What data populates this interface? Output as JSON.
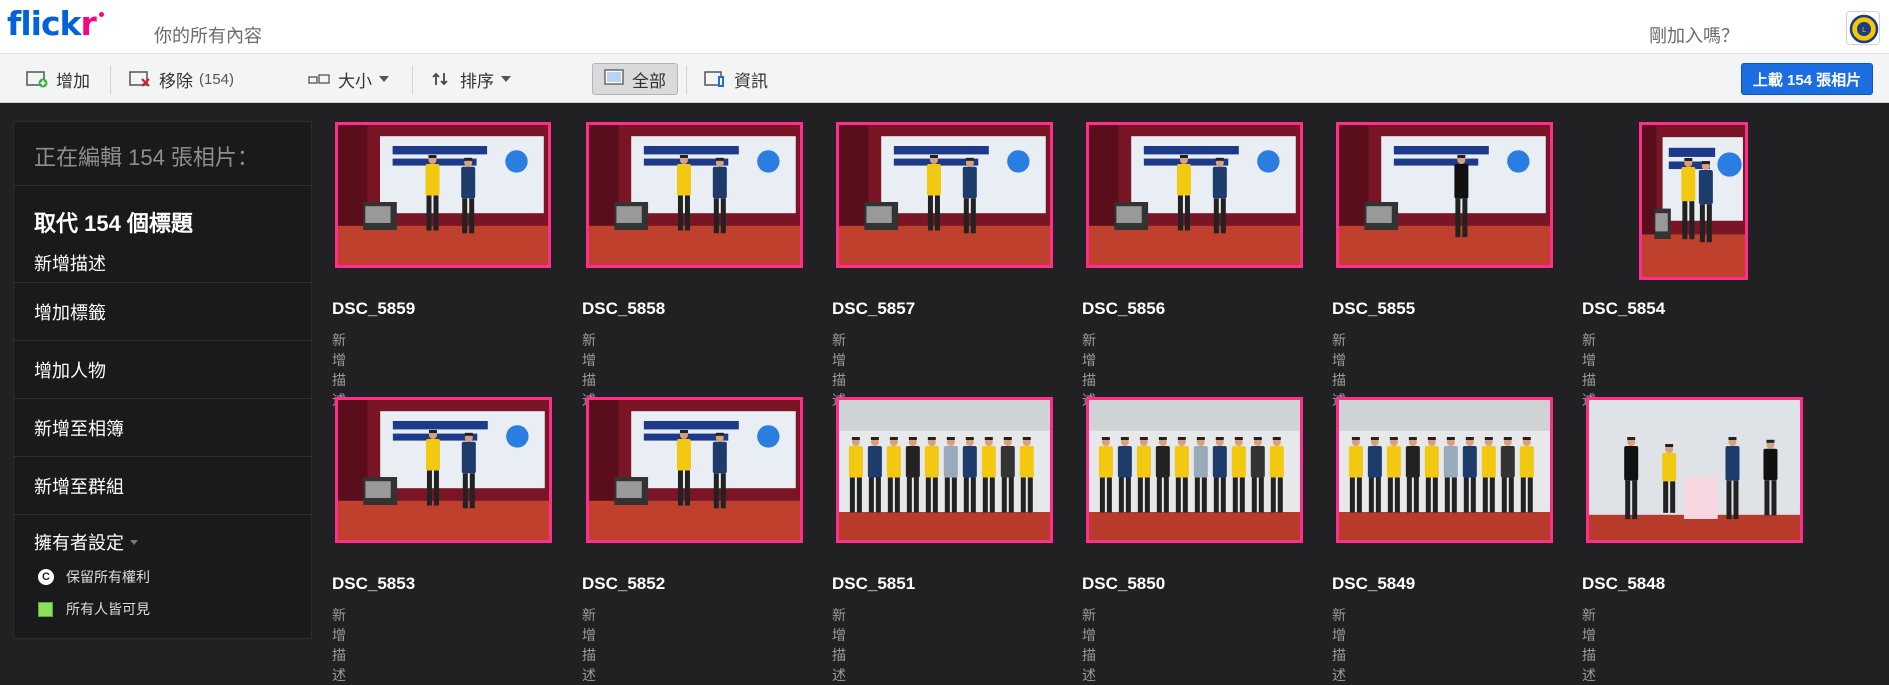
{
  "header": {
    "logo_text": "flick",
    "logo_text_r": "r",
    "title": "你的所有內容",
    "join_link": "剛加入嗎？"
  },
  "toolbar": {
    "add_label": "增加",
    "remove_label": "移除",
    "remove_count": "(154)",
    "size_label": "大小",
    "sort_label": "排序",
    "all_label": "全部",
    "info_label": "資訊",
    "upload_label": "上載 154 張相片"
  },
  "sidebar": {
    "editing_heading": "正在編輯 154 張相片：",
    "replace_title": "取代 154 個標題",
    "add_description": "新增描述",
    "items": [
      {
        "label": "增加標籤"
      },
      {
        "label": "增加人物"
      },
      {
        "label": "新增至相簿"
      },
      {
        "label": "新增至群組"
      }
    ],
    "owner_settings": {
      "title": "擁有者設定",
      "copyright": "保留所有權利",
      "copyright_icon": "C",
      "visibility": "所有人皆可見"
    }
  },
  "photos": [
    {
      "title": "DSC_5859",
      "desc": "新增描述"
    },
    {
      "title": "DSC_5858",
      "desc": "新增描述"
    },
    {
      "title": "DSC_5857",
      "desc": "新增描述"
    },
    {
      "title": "DSC_5856",
      "desc": "新增描述"
    },
    {
      "title": "DSC_5855",
      "desc": "新增描述"
    },
    {
      "title": "DSC_5854",
      "desc": "新增描述"
    },
    {
      "title": "DSC_5853",
      "desc": "新增描述"
    },
    {
      "title": "DSC_5852",
      "desc": "新增描述"
    },
    {
      "title": "DSC_5851",
      "desc": "新增描述"
    },
    {
      "title": "DSC_5850",
      "desc": "新增描述"
    },
    {
      "title": "DSC_5849",
      "desc": "新增描述"
    },
    {
      "title": "DSC_5848",
      "desc": "新增描述"
    }
  ],
  "colors": {
    "brand_blue": "#0063dc",
    "brand_pink": "#ff0084",
    "selection_border": "#ff2d8c",
    "upload_button": "#1c6ee0"
  }
}
